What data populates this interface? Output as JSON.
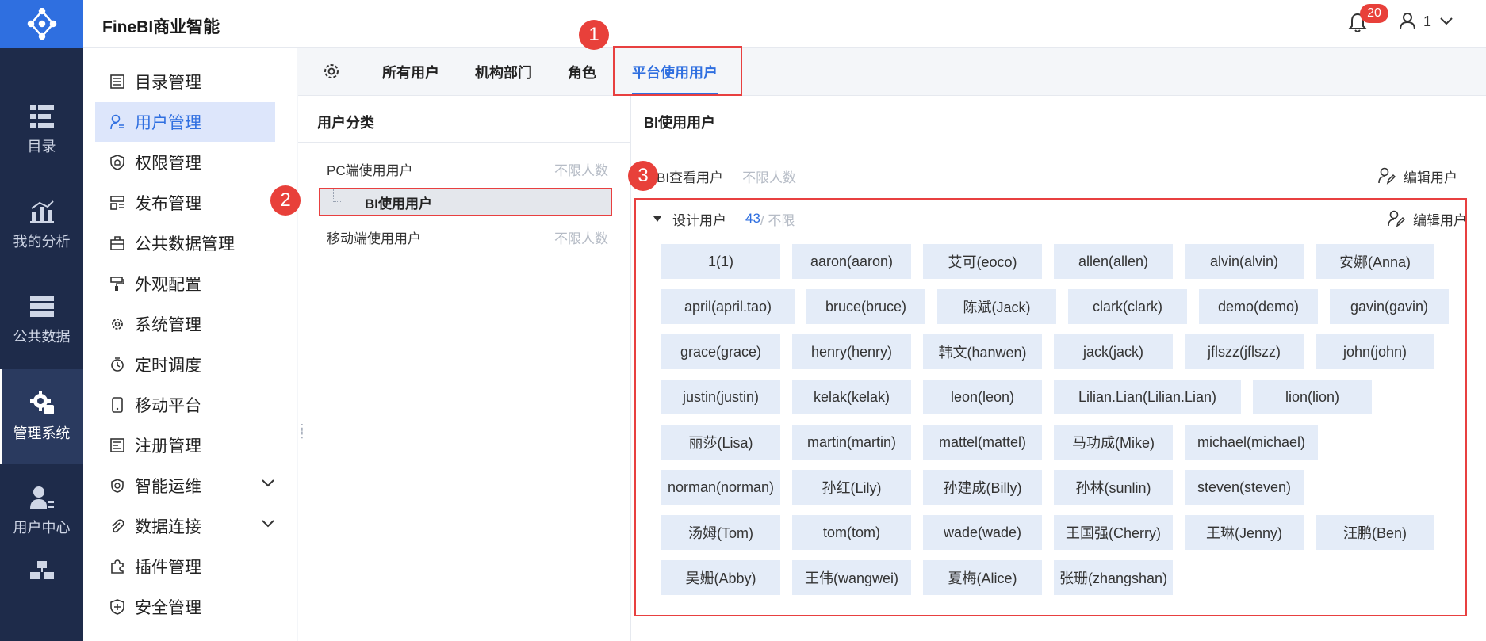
{
  "app": {
    "title": "FineBI商业智能"
  },
  "header": {
    "notification_count": "20",
    "user_name": "1"
  },
  "rail": {
    "items": [
      {
        "label": "目录",
        "icon": "list-icon"
      },
      {
        "label": "我的分析",
        "icon": "analysis-icon"
      },
      {
        "label": "公共数据",
        "icon": "database-icon"
      },
      {
        "label": "管理系统",
        "icon": "settings-gear-icon",
        "active": true
      },
      {
        "label": "用户中心",
        "icon": "user-center-icon"
      }
    ]
  },
  "sidebar": {
    "items": [
      {
        "label": "目录管理",
        "icon": "catalog-icon"
      },
      {
        "label": "用户管理",
        "icon": "user-icon",
        "active": true
      },
      {
        "label": "权限管理",
        "icon": "shield-icon"
      },
      {
        "label": "发布管理",
        "icon": "publish-icon"
      },
      {
        "label": "公共数据管理",
        "icon": "briefcase-icon"
      },
      {
        "label": "外观配置",
        "icon": "paint-icon"
      },
      {
        "label": "系统管理",
        "icon": "gear-icon"
      },
      {
        "label": "定时调度",
        "icon": "timer-icon"
      },
      {
        "label": "移动平台",
        "icon": "mobile-icon"
      },
      {
        "label": "注册管理",
        "icon": "register-icon"
      },
      {
        "label": "智能运维",
        "icon": "ops-icon",
        "expandable": true
      },
      {
        "label": "数据连接",
        "icon": "paperclip-icon",
        "expandable": true
      },
      {
        "label": "插件管理",
        "icon": "puzzle-icon"
      },
      {
        "label": "安全管理",
        "icon": "security-shield-icon"
      }
    ]
  },
  "tabs": [
    {
      "label": "所有用户"
    },
    {
      "label": "机构部门"
    },
    {
      "label": "角色"
    },
    {
      "label": "平台使用用户",
      "active": true
    }
  ],
  "category_panel": {
    "title": "用户分类",
    "rows": [
      {
        "label": "PC端使用用户",
        "limit": "不限人数"
      },
      {
        "label": "BI使用用户",
        "selected": true
      },
      {
        "label": "移动端使用用户",
        "limit": "不限人数"
      }
    ]
  },
  "bi_panel": {
    "title": "BI使用用户",
    "viewer_group": {
      "name": "BI查看用户",
      "limit": "不限人数",
      "edit_label": "编辑用户"
    },
    "design_group": {
      "name": "设计用户",
      "count": "43",
      "limit": " / 不限",
      "edit_label": "编辑用户"
    },
    "users": [
      [
        "1(1)",
        "aaron(aaron)",
        "艾可(eoco)",
        "allen(allen)",
        "alvin(alvin)",
        "安娜(Anna)"
      ],
      [
        "april(april.tao)",
        "bruce(bruce)",
        "陈斌(Jack)",
        "clark(clark)",
        "demo(demo)",
        "gavin(gavin)"
      ],
      [
        "grace(grace)",
        "henry(henry)",
        "韩文(hanwen)",
        "jack(jack)",
        "jflszz(jflszz)",
        "john(john)"
      ],
      [
        "justin(justin)",
        "kelak(kelak)",
        "leon(leon)",
        "Lilian.Lian(Lilian.Lian)",
        "lion(lion)"
      ],
      [
        "丽莎(Lisa)",
        "martin(martin)",
        "mattel(mattel)",
        "马功成(Mike)",
        "michael(michael)"
      ],
      [
        "norman(norman)",
        "孙红(Lily)",
        "孙建成(Billy)",
        "孙林(sunlin)",
        "steven(steven)"
      ],
      [
        "汤姆(Tom)",
        "tom(tom)",
        "wade(wade)",
        "王国强(Cherry)",
        "王琳(Jenny)",
        "汪鹏(Ben)"
      ],
      [
        "吴姗(Abby)",
        "王伟(wangwei)",
        "夏梅(Alice)",
        "张珊(zhangshan)"
      ]
    ]
  },
  "annotations": {
    "marker1": "1",
    "marker2": "2",
    "marker3": "3"
  },
  "colors": {
    "accent": "#2f6fe0",
    "rail_bg": "#1e2b4a",
    "highlight": "#e84040",
    "chip_bg": "#e4ecf8"
  }
}
